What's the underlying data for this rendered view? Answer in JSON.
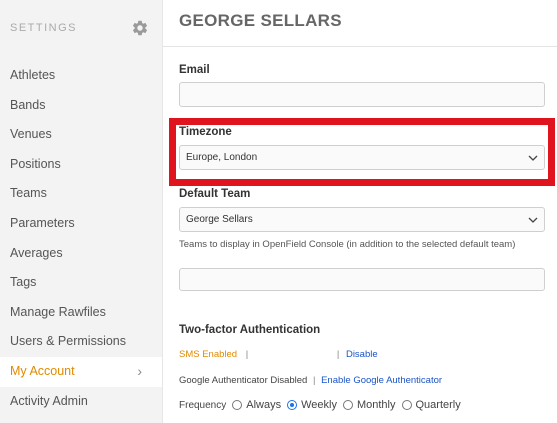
{
  "sidebar": {
    "title": "SETTINGS",
    "items": [
      {
        "label": "Athletes"
      },
      {
        "label": "Bands"
      },
      {
        "label": "Venues"
      },
      {
        "label": "Positions"
      },
      {
        "label": "Teams"
      },
      {
        "label": "Parameters"
      },
      {
        "label": "Averages"
      },
      {
        "label": "Tags"
      },
      {
        "label": "Manage Rawfiles"
      },
      {
        "label": "Users & Permissions"
      },
      {
        "label": "My Account",
        "active": true
      },
      {
        "label": "Activity Admin"
      }
    ]
  },
  "main": {
    "title": "GEORGE SELLARS",
    "email": {
      "label": "Email",
      "value": ""
    },
    "timezone": {
      "label": "Timezone",
      "value": "Europe, London"
    },
    "default_team": {
      "label": "Default Team",
      "value": "George Sellars"
    },
    "teams_hint": "Teams to display in OpenField Console (in addition to the selected default team)",
    "teams_value": "",
    "two_factor": {
      "heading": "Two-factor Authentication",
      "sms_status": "SMS Enabled",
      "sms_sep": "|",
      "sms_link": "Disable",
      "google_status": "Google Authenticator Disabled",
      "google_sep": "|",
      "google_link": "Enable Google Authenticator",
      "frequency_label": "Frequency",
      "frequency_options": [
        "Always",
        "Weekly",
        "Monthly",
        "Quarterly"
      ],
      "frequency_selected": "Weekly"
    }
  },
  "colors": {
    "accent": "#e08a00",
    "link": "#1a55c8",
    "highlight": "#e0141f"
  }
}
